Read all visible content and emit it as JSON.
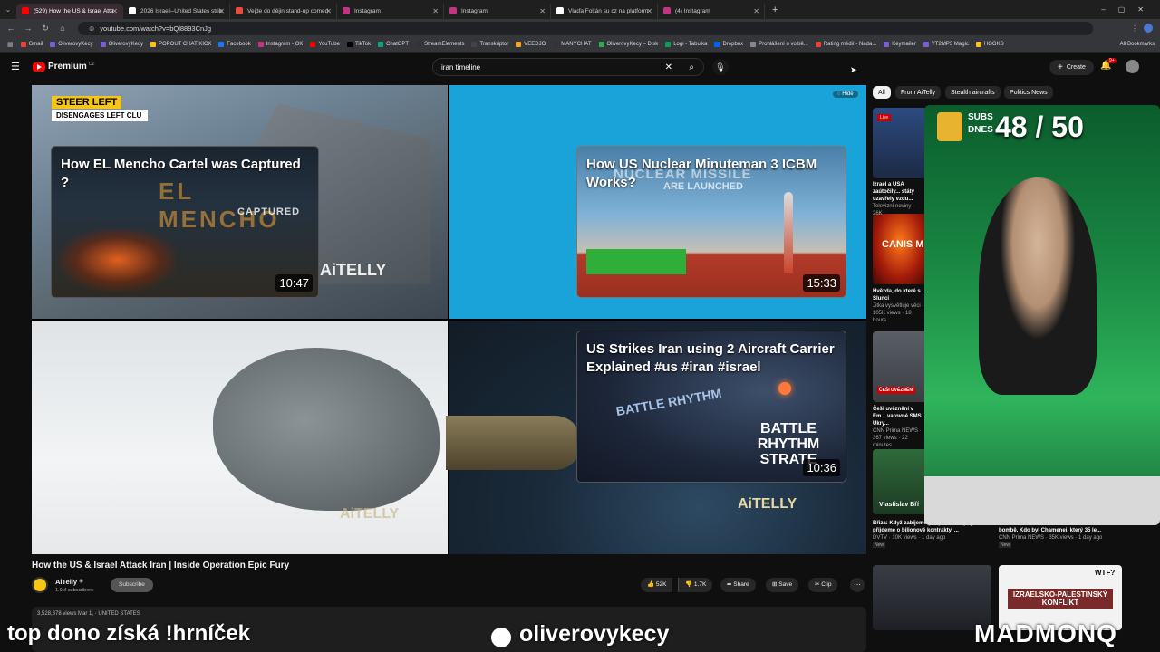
{
  "browser": {
    "tabs": [
      {
        "title": "(529) How the US & Israel Atta",
        "color": "#ff0000",
        "active": true
      },
      {
        "title": "2026 Israeli–United States strik",
        "color": "#ffffff",
        "active": false
      },
      {
        "title": "Vejde do dějin stand-up comed",
        "color": "#e94b3c",
        "active": false
      },
      {
        "title": "Instagram",
        "color": "#c13584",
        "active": false
      },
      {
        "title": "Instagram",
        "color": "#c13584",
        "active": false
      },
      {
        "title": "Vláďa Foltán su cz na platform",
        "color": "#ffffff",
        "active": false
      },
      {
        "title": "(4) Instagram",
        "color": "#c13584",
        "active": false
      }
    ],
    "url": "youtube.com/watch?v=bQl8893CnJg",
    "bookmarks": [
      "Gmail",
      "OliverovyKecy",
      "OliverovyKecy",
      "POPOUT CHAT KICK",
      "Facebook",
      "Instagram - OK",
      "YouTube",
      "TikTok",
      "ChatGPT",
      "StreamElements",
      "Transkriptor",
      "VEEDJO",
      "MANYCHAT",
      "OliverovyKecy – Disk",
      "Logi - Tabulka",
      "Dropbox",
      "Prohlášení o volbě...",
      "Rating médií - Nada...",
      "Keymailer",
      "YT2MP3 Magic",
      "HOOKS"
    ],
    "all_bookmarks": "All Bookmarks"
  },
  "youtube": {
    "logo": "Premium",
    "logo_sup": "CZ",
    "search_value": "iran timeline",
    "create_label": "Create",
    "notif_count": "9+"
  },
  "endscreen": {
    "hide_label": "Hide",
    "cards": [
      {
        "title": "How EL Mencho Cartel was Captured ?",
        "duration": "10:47",
        "overlay1": "EL MENCHO",
        "overlay2": "CAPTURED"
      },
      {
        "title": "How US Nuclear Minuteman 3 ICBM Works?",
        "duration": "15:33",
        "overlay1": "NUCLEAR MISSILE",
        "overlay2": "ARE LAUNCHED"
      },
      {
        "title": "US Strikes Iran using 2 Aircraft Carrier Explained #us #iran #israel",
        "duration": "10:36",
        "overlay1": "BATTLE RHYTHM",
        "overlay2": "BATTLE RHYTHM STRATE"
      }
    ],
    "steer_left": "STEER LEFT",
    "disengages": "DISENGAGES LEFT CLU",
    "brand": "AiTELLY"
  },
  "video": {
    "title": "How the US & Israel Attack Iran | Inside Operation Epic Fury",
    "channel": "AiTelly",
    "subs": "1.9M subscribers",
    "subscribe_label": "Subscribe",
    "likes": "52K",
    "dislikes": "1.7K",
    "share": "Share",
    "save": "Save",
    "clip": "Clip",
    "views": "3,528,378 views  Mar 1,  ·  UNITED STATES"
  },
  "chips": [
    "All",
    "From AiTelly",
    "Stealth aircrafts",
    "Politics News"
  ],
  "recommendations": [
    {
      "title": "Izrael a USA zaútočily... státy uzavřely vzdu...",
      "meta": "Televizní noviny · 26K"
    },
    {
      "title": "Hvězda, do které s... Slunci",
      "meta": "Jitka vysvětluje věci · 105K views · 18 hours"
    },
    {
      "title": "Češi uvěznění v Em... varovné SMS. Ukry...",
      "meta": "CNN Prima NEWS · 367 views · 22 minutes"
    },
    {
      "title": "Břiza: Když zabijeme podporu Ukrajiny, přijdeme o bilionové kontrakty. ...",
      "meta": "DVTV · 10K views · 1 day ago",
      "badge": "New"
    },
    {
      "title": "Izrael: ráno na to že budu tu aktuálně Cent ... bombě. Kdo byl Chamenei, který 35 le...",
      "meta": "CNN Prima NEWS · 35K views · 1 day ago",
      "badge": "New"
    }
  ],
  "rec_thumb_text": {
    "live": "Live",
    "canis": "CANIS M",
    "cesi": "ČEŠI UVĚZNĚNÍ",
    "vlastislav": "Vlastislav Bří",
    "konflikt": "IZRAELSKO-PALESTINSKÝ KONFLIKT",
    "wtf": "WTF?"
  },
  "streamer": {
    "subs_label_top": "SUBS",
    "subs_label_bottom": "DNES",
    "subs_count": "48 / 50"
  },
  "bottom_overlay": {
    "left": "top dono získá !hrníček",
    "center": "oliverovykecy",
    "right": "MADMONQ"
  }
}
